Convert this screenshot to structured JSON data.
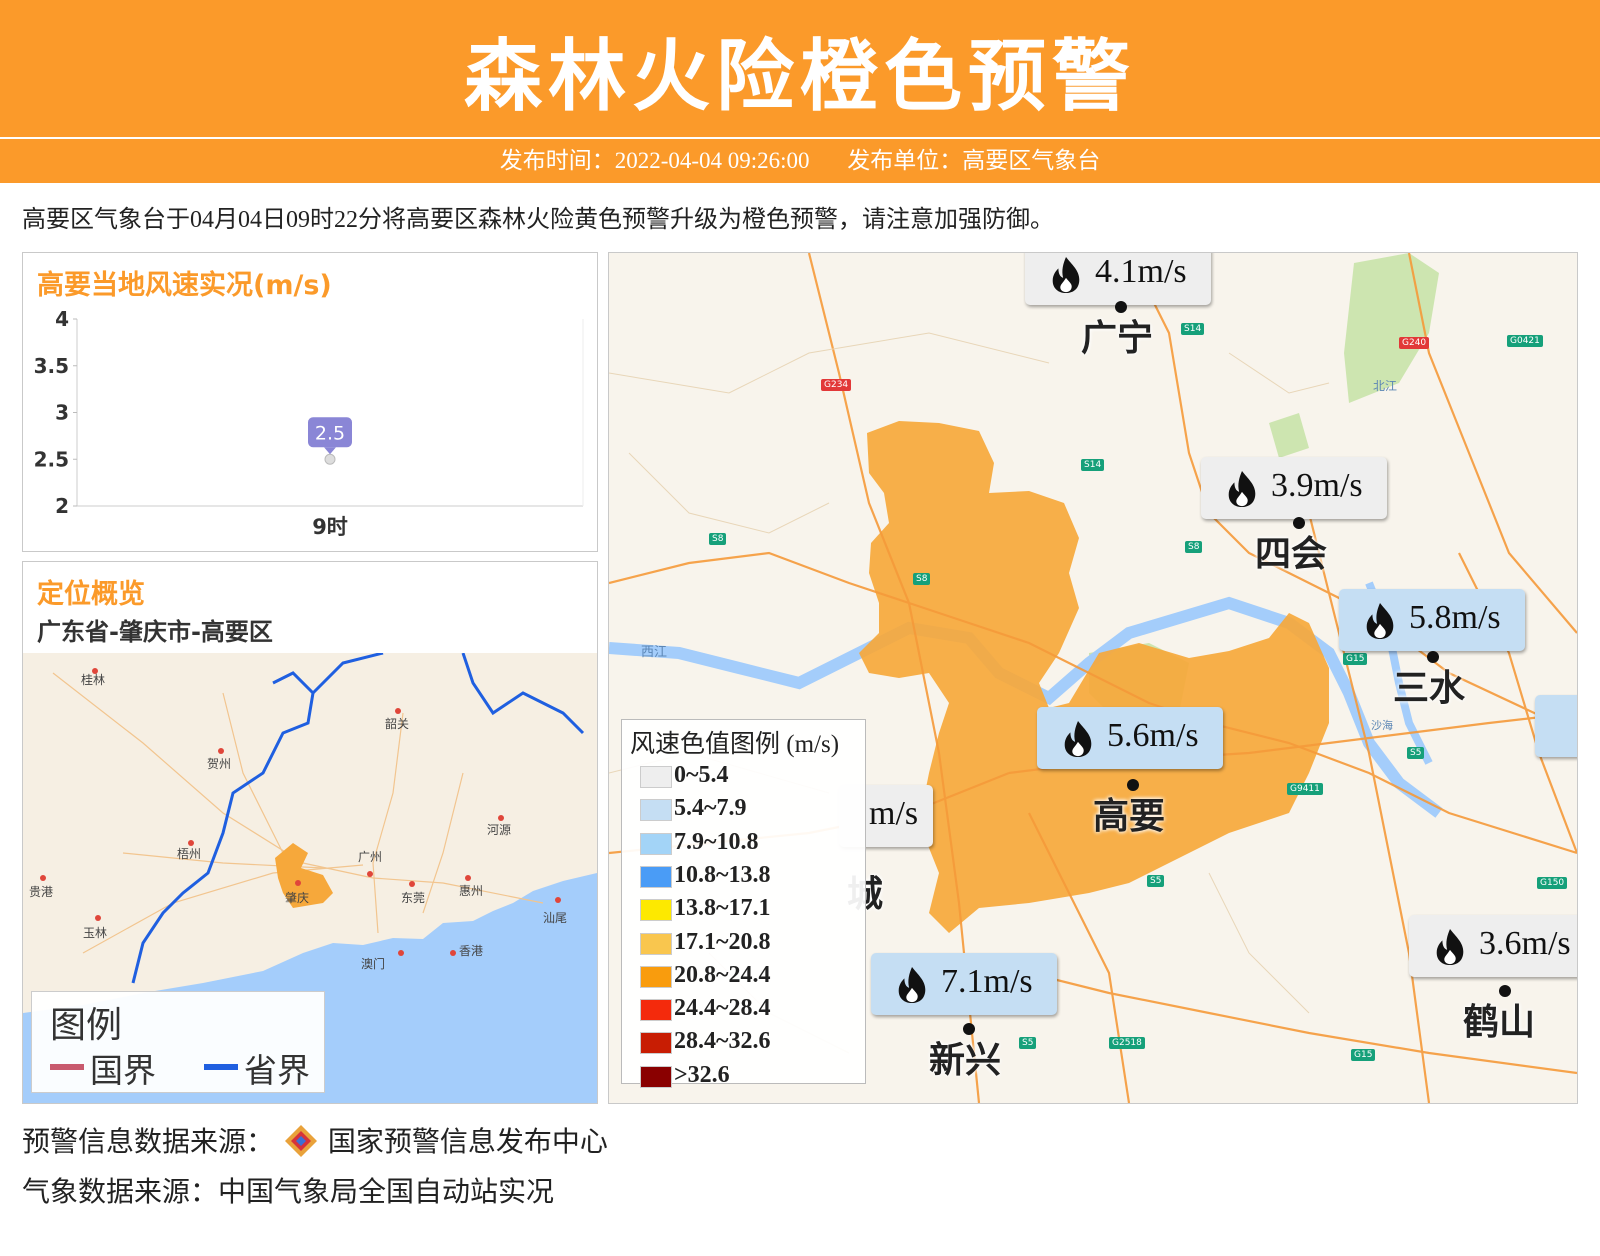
{
  "header": {
    "title": "森林火险橙色预警",
    "publish_time": "发布时间：2022-04-04 09:26:00",
    "publisher": "发布单位：高要区气象台"
  },
  "description": "高要区气象台于04月04日09时22分将高要区森林火险黄色预警升级为橙色预警，请注意加强防御。",
  "wind_panel": {
    "title": "高要当地风速实况(m/s)"
  },
  "chart_data": {
    "type": "scatter",
    "title": "高要当地风速实况(m/s)",
    "categories": [
      "9时"
    ],
    "values": [
      2.5
    ],
    "data_labels": [
      "2.5"
    ],
    "ylim": [
      2,
      4
    ],
    "yticks": [
      "4",
      "3.5",
      "3",
      "2.5",
      "2"
    ],
    "grid": false
  },
  "location_panel": {
    "title": "定位概览",
    "path": "广东省-肇庆市-高要区",
    "cities": [
      "桂林",
      "韶关",
      "贺州",
      "梧州",
      "广州",
      "河源",
      "贵港",
      "肇庆",
      "东莞",
      "惠州",
      "玉林",
      "澳门",
      "香港",
      "汕尾"
    ],
    "legend": {
      "title": "图例",
      "national": "国界",
      "provincial": "省界",
      "national_color": "#c85a6e",
      "provincial_color": "#1f5fe0"
    }
  },
  "map": {
    "region_color": "#f6a83b",
    "river_label": "西江",
    "river_label2": "北江",
    "river_label3": "沙海",
    "road_shields": [
      "S14",
      "S14",
      "G234",
      "G240",
      "G0421",
      "S8",
      "S8",
      "S8",
      "G15",
      "S5",
      "G9411",
      "S5",
      "S5",
      "G2518",
      "G15",
      "G150"
    ],
    "stations": [
      {
        "name": "广宁",
        "value": "4.1m/s"
      },
      {
        "name": "四会",
        "value": "3.9m/s"
      },
      {
        "name": "三水",
        "value": "5.8m/s"
      },
      {
        "name": "高要",
        "value": "5.6m/s"
      },
      {
        "name": "新兴",
        "value": "7.1m/s"
      },
      {
        "name": "鹤山",
        "value": "3.6m/s"
      }
    ],
    "partial_value": "m/s",
    "partial_name": "城",
    "legend": {
      "title": "风速色值图例 (m/s)",
      "items": [
        {
          "label": "0~5.4",
          "color": "#eeeeee"
        },
        {
          "label": "5.4~7.9",
          "color": "#c5def3"
        },
        {
          "label": "7.9~10.8",
          "color": "#a3d4f7"
        },
        {
          "label": "10.8~13.8",
          "color": "#4a9cf6"
        },
        {
          "label": "13.8~17.1",
          "color": "#fde900"
        },
        {
          "label": "17.1~20.8",
          "color": "#f9c64e"
        },
        {
          "label": "20.8~24.4",
          "color": "#f99c0d"
        },
        {
          "label": "24.4~28.4",
          "color": "#f42a0c"
        },
        {
          "label": "28.4~32.6",
          "color": "#c81d03"
        },
        {
          "label": ">32.6",
          "color": "#8a0000"
        }
      ]
    }
  },
  "footer": {
    "warning_source": "预警信息数据来源：",
    "warning_center": "国家预警信息发布中心",
    "weather_source": "气象数据来源：中国气象局全国自动站实况"
  }
}
